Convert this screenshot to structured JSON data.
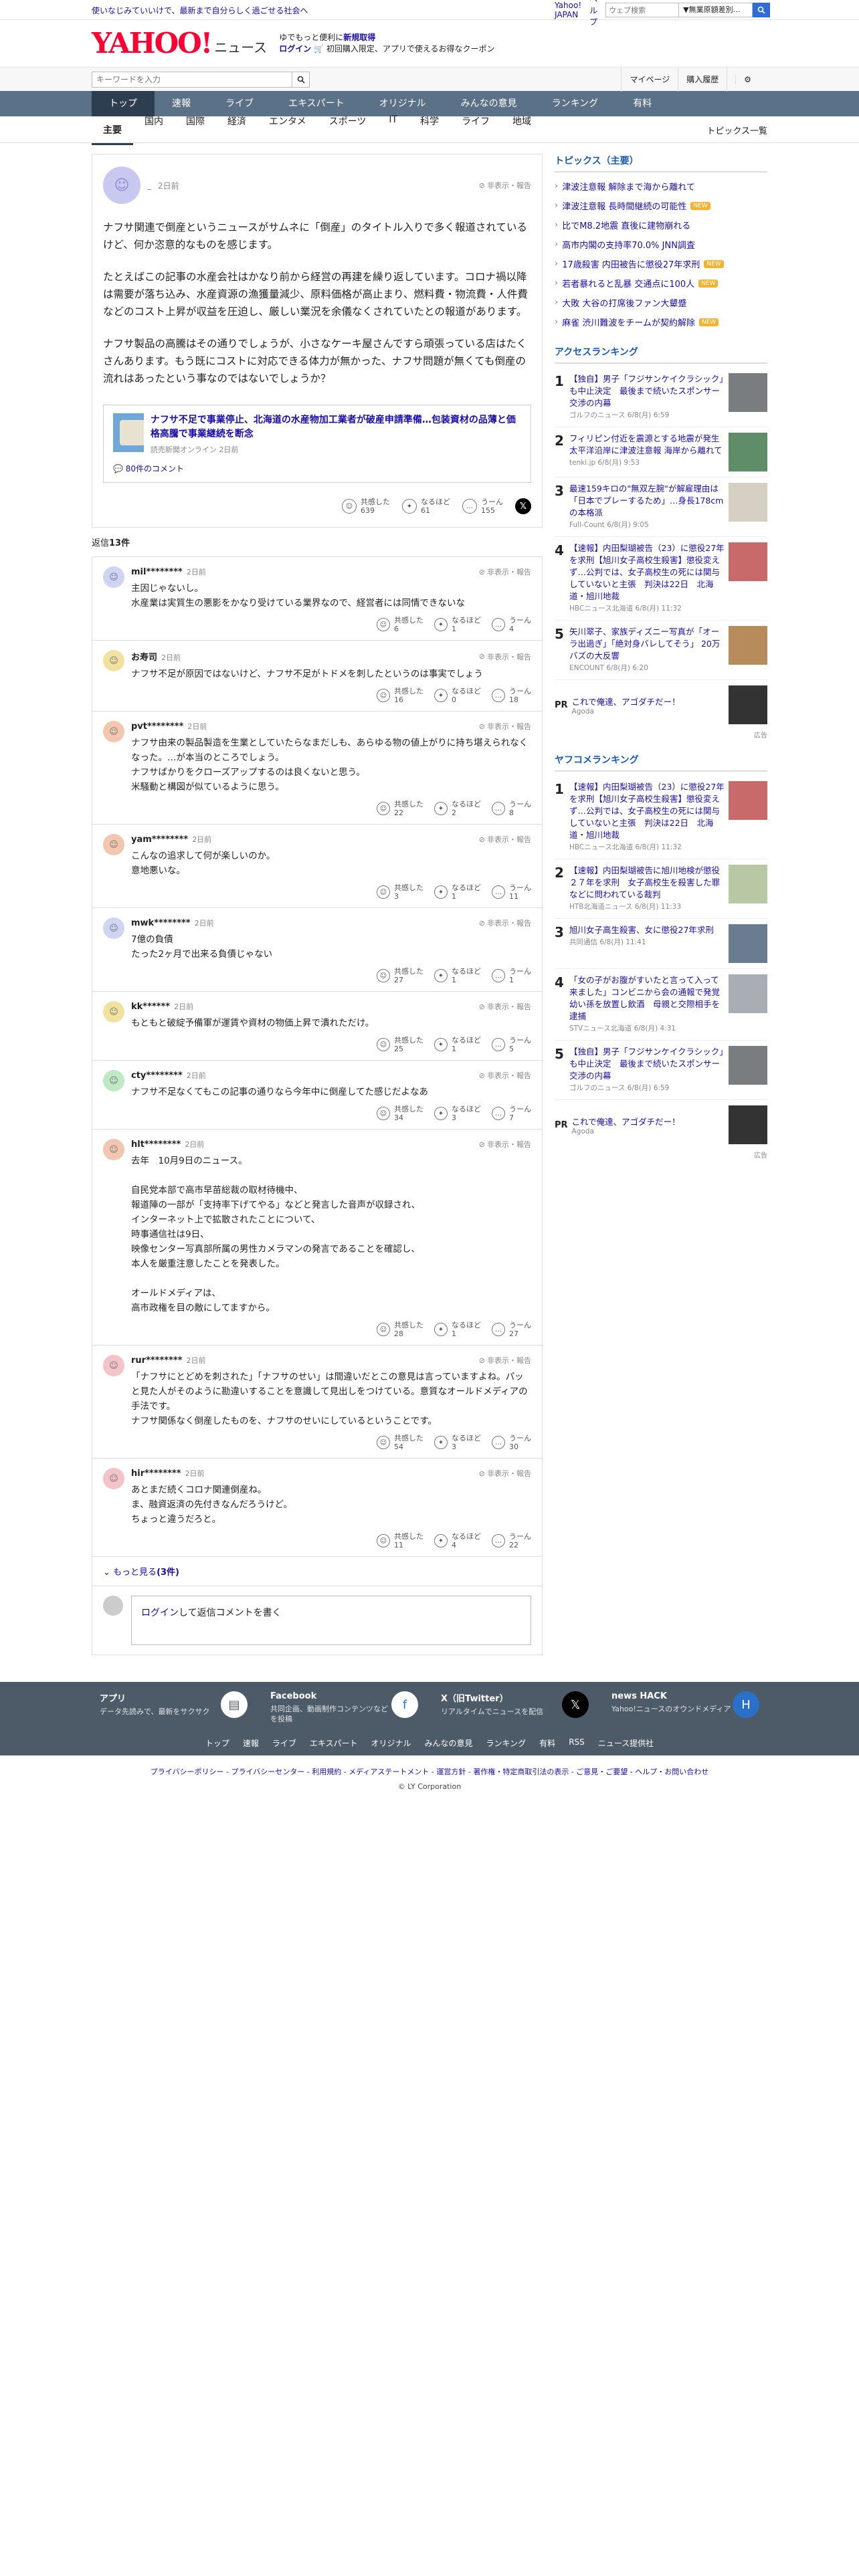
{
  "topbar": {
    "promo": "使いなじみていいけで、最新まで自分らしく過ごせる社会へ",
    "links": [
      "Yahoo! JAPAN",
      "ヘルプ"
    ],
    "search_placeholder": "ウェブ検索",
    "search_select": "▼無業原額差別…"
  },
  "header": {
    "logo": "YAHOO!",
    "logo_sub": "ニュース",
    "promo_line1a": "ゆでもっと便利に",
    "promo_line1b": "新規取得",
    "promo_line2a": "ログイン",
    "promo_line2b": "初回購入限定、アプリで使えるお得なクーポン"
  },
  "searchrow": {
    "placeholder": "キーワードを入力",
    "mypage": "マイページ",
    "history": "購入履歴"
  },
  "nav": [
    "トップ",
    "速報",
    "ライブ",
    "エキスパート",
    "オリジナル",
    "みんなの意見",
    "ランキング",
    "有料"
  ],
  "subnav": [
    "主要",
    "国内",
    "国際",
    "経済",
    "エンタメ",
    "スポーツ",
    "IT",
    "科学",
    "ライフ",
    "地域"
  ],
  "subnav_all": "トピックス一覧",
  "post": {
    "user": "_",
    "time": "2日前",
    "report": "非表示・報告",
    "paragraphs": [
      "ナフサ関連で倒産というニュースがサムネに「倒産」のタイトル入りで多く報道されているけど、何か恣意的なものを感じます。",
      "たとえばこの記事の水産会社はかなり前から経営の再建を繰り返しています。コロナ禍以降は需要が落ち込み、水産資源の漁獲量減少、原料価格が高止まり、燃料費・物流費・人件費などのコスト上昇が収益を圧迫し、厳しい業況を余儀なくされていたとの報道があります。",
      "ナフサ製品の高騰はその通りでしょうが、小さなケーキ屋さんですら頑張っている店はたくさんあります。もう既にコストに対応できる体力が無かった、ナフサ問題が無くても倒産の流れはあったという事なのではないでしょうか？"
    ],
    "source_title": "ナフサ不足で事業停止、北海道の水産物加工業者が破産申請準備…包装資材の品薄と価格高騰で事業継続を断念",
    "source_pub": "読売新聞オンライン 2日前",
    "source_comments": "80件のコメント",
    "reactions": [
      {
        "label": "共感した",
        "count": "639"
      },
      {
        "label": "なるほど",
        "count": "61"
      },
      {
        "label": "うーん",
        "count": "155"
      }
    ]
  },
  "replies_label": "返信",
  "replies_count": "13件",
  "replies": [
    {
      "name": "mil********",
      "time": "2日前",
      "color": "#d0d4f4",
      "text": "主因じゃないし。\n水産業は実質生の悪影をかなり受けている業界なので、経営者には同情できないな",
      "r": [
        "6",
        "1",
        "4"
      ]
    },
    {
      "name": "お寿司",
      "time": "2日前",
      "color": "#f2e2a0",
      "text": "ナフサ不足が原因ではないけど、ナフサ不足がトドメを刺したというのは事実でしょう",
      "r": [
        "16",
        "0",
        "18"
      ]
    },
    {
      "name": "pvt********",
      "time": "2日前",
      "color": "#f3c6b0",
      "text": "ナフサ由来の製品製造を生業としていたらなまだしも、あらゆる物の値上がりに持ち堪えられなくなった。…が本当のところでしょう。\nナフサばかりをクローズアップするのは良くないと思う。\n米騒動と構図が似ているように思う。",
      "r": [
        "22",
        "2",
        "8"
      ]
    },
    {
      "name": "yam********",
      "time": "2日前",
      "color": "#f3c6b0",
      "text": "こんなの追求して何が楽しいのか。\n意地悪いな。",
      "r": [
        "3",
        "1",
        "11"
      ]
    },
    {
      "name": "mwk********",
      "time": "2日前",
      "color": "#d0d4f4",
      "text": "7億の負債\nたった2ヶ月で出来る負債じゃない",
      "r": [
        "27",
        "1",
        "1"
      ]
    },
    {
      "name": "kk******",
      "time": "2日前",
      "color": "#f2e2a0",
      "text": "もともと破綻予備軍が運賃や資材の物価上昇で潰れただけ。",
      "r": [
        "25",
        "1",
        "5"
      ]
    },
    {
      "name": "cty********",
      "time": "2日前",
      "color": "#bfe8c4",
      "text": "ナフサ不足なくてもこの記事の通りなら今年中に倒産してた感じだよなあ",
      "r": [
        "34",
        "3",
        "7"
      ]
    },
    {
      "name": "hlt********",
      "time": "2日前",
      "color": "#f3c6b0",
      "text": "去年　10月9日のニュース。\n\n自民党本部で高市早苗総裁の取材待機中、\n報道陣の一部が「支持率下げてやる」などと発言した音声が収録され、\nインターネット上で拡散されたことについて、\n時事通信社は9日、\n映像センター写真部所属の男性カメラマンの発言であることを確認し、\n本人を厳重注意したことを発表した。\n\nオールドメディアは、\n高市政権を目の敵にしてますから。",
      "r": [
        "28",
        "1",
        "27"
      ]
    },
    {
      "name": "rur********",
      "time": "2日前",
      "color": "#f4c3c8",
      "text": "「ナフサにとどめを刺された」「ナフサのせい」は間違いだとこの意見は言っていますよね。パッと見た人がそのように勘違いすることを意識して見出しをつけている。意質なオールドメディアの手法です。\nナフサ関係なく倒産したものを、ナフサのせいにしているということです。",
      "r": [
        "54",
        "3",
        "30"
      ]
    },
    {
      "name": "hir********",
      "time": "2日前",
      "color": "#f4c3c8",
      "text": "あとまだ続くコロナ関連倒産ね。\nま、融資返済の先付きなんだろうけど。\nちょっと違うだろと。",
      "r": [
        "11",
        "4",
        "22"
      ]
    }
  ],
  "more_label": "もっと見る",
  "more_count": "(3件)",
  "compose_login": "ログイン",
  "compose_text": "して返信コメントを書く",
  "topics_title": "トピックス（主要）",
  "topics": [
    {
      "t": "津波注意報 解除まで海から離れて",
      "b": ""
    },
    {
      "t": "津波注意報 長時間継続の可能性",
      "b": "NEW"
    },
    {
      "t": "比でM8.2地震 直後に建物崩れる",
      "b": ""
    },
    {
      "t": "高市内閣の支持率70.0% JNN調査",
      "b": ""
    },
    {
      "t": "17歳殺害 内田被告に懲役27年求刑",
      "b": "NEW"
    },
    {
      "t": "若者暴れると乱暴 交通点に100人",
      "b": "NEW"
    },
    {
      "t": "大敗 大谷の打席後ファン大顰蹙",
      "b": ""
    },
    {
      "t": "麻雀 渋川難波をチームが契約解除",
      "b": "NEW"
    }
  ],
  "access_title": "アクセスランキング",
  "access": [
    {
      "no": "1",
      "t": "【独自】男子「フジサンケイクラシック」も中止決定　最後まで続いたスポンサー交渉の内幕",
      "s": "ゴルフのニュース 6/8(月) 6:59",
      "c": "#7a7d80"
    },
    {
      "no": "2",
      "t": "フィリピン付近を震源とする地震が発生　太平洋沿岸に津波注意報 海岸から離れて",
      "s": "tenki.jp 6/8(月) 9:53",
      "c": "#5f8d68"
    },
    {
      "no": "3",
      "t": "最速159キロの\"無双左腕\"が解雇理由は「日本でプレーするため」…身長178cmの本格派",
      "s": "Full-Count 6/8(月) 9:05",
      "c": "#d6d0c4"
    },
    {
      "no": "4",
      "t": "【速報】内田梨瑚被告（23）に懲役27年を求刑【旭川女子高校生殺害】懲役変えず…公判では、女子高校生の死には関与していないと主張　判決は22日　北海道・旭川地裁",
      "s": "HBCニュース北海道 6/8(月) 11:32",
      "c": "#c86a6a"
    },
    {
      "no": "5",
      "t": "矢川翠子、家族ディズニー写真が「オーラ出過ぎ」「絶対身バレしてそう」 20万バズの大反響",
      "s": "ENCOUNT 6/8(月) 6:20",
      "c": "#b78b5a"
    }
  ],
  "pr_label": "PR",
  "pr_title": "これで俺達、アゴダチだー！",
  "pr_src": "Agoda",
  "ad_label": "広告",
  "yafuko_title": "ヤフコメランキング",
  "yafuko": [
    {
      "no": "1",
      "t": "【速報】内田梨瑚被告（23）に懲役27年を求刑【旭川女子高校生殺害】懲役変えず…公判では、女子高校生の死には関与していないと主張　判決は22日　北海道・旭川地裁",
      "s": "HBCニュース北海道 6/8(月) 11:32",
      "c": "#c86a6a"
    },
    {
      "no": "2",
      "t": "【速報】内田梨瑚被告に旭川地検が懲役２７年を求刑　女子高校生を殺害した罪などに問われている裁判",
      "s": "HTB北海道ニュース 6/8(月) 11:33",
      "c": "#b8c8a4"
    },
    {
      "no": "3",
      "t": "旭川女子高生殺害、女に懲役27年求刑",
      "s": "共同通信 6/8(月) 11:41",
      "c": "#6a7c90"
    },
    {
      "no": "4",
      "t": "「女の子がお腹がすいたと言って入って来ました」コンビニから会の通報で発覚　幼い孫を放置し飲酒　母親と交際相手を逮捕",
      "s": "STVニュース北海道 6/8(月) 4:31",
      "c": "#a8aeb4"
    },
    {
      "no": "5",
      "t": "【独自】男子「フジサンケイクラシック」も中止決定　最後まで続いたスポンサー交渉の内幕",
      "s": "ゴルフのニュース 6/8(月) 6:59",
      "c": "#7a7d80"
    }
  ],
  "footer": {
    "services": [
      {
        "nm": "アプリ",
        "ds": "データ先読みで、最新をサクサク",
        "ic": "▤"
      },
      {
        "nm": "Facebook",
        "ds": "共同企画、動画制作コンテンツなどを投稿",
        "ic": "f"
      },
      {
        "nm": "X（旧Twitter）",
        "ds": "リアルタイムでニュースを配信",
        "ic": "𝕏"
      },
      {
        "nm": "news HACK",
        "ds": "Yahoo!ニュースのオウンドメディア",
        "ic": "H"
      }
    ],
    "links": [
      "トップ",
      "速報",
      "ライブ",
      "エキスパート",
      "オリジナル",
      "みんなの意見",
      "ランキング",
      "有料",
      "RSS",
      "ニュース提供社"
    ],
    "legal": "プライバシーポリシー - プライバシーセンター - 利用規約 - メディアステートメント - 運営方針 - 著作権・特定商取引法の表示 - ご意見・ご要望 - ヘルプ・お問い合わせ",
    "copy": "© LY Corporation"
  }
}
